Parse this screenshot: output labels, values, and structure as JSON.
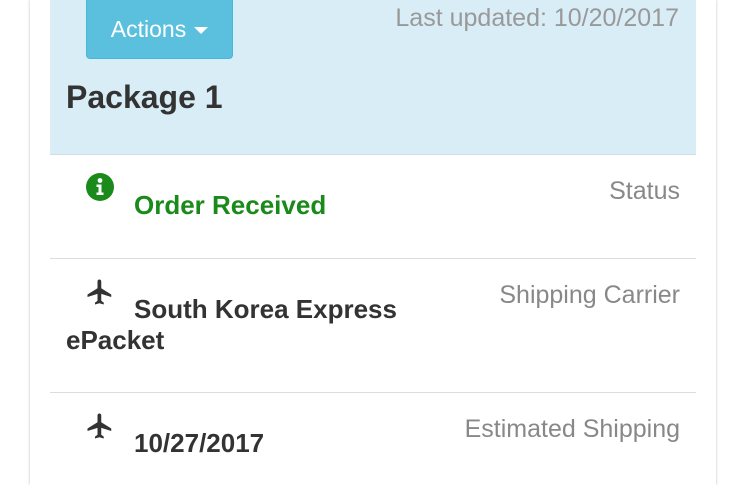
{
  "header": {
    "actions_label": "Actions",
    "last_updated": "Last updated: 10/20/2017",
    "package_title": "Package 1",
    "bg_color": "#d9edf7",
    "button_color": "#5bc0de"
  },
  "rows": [
    {
      "icon": "info-circle-icon",
      "value": "Order Received",
      "label": "Status",
      "value_color": "#1a8a1a"
    },
    {
      "icon": "airplane-icon",
      "value": "South Korea Express ePacket",
      "label": "Shipping Carrier"
    },
    {
      "icon": "airplane-icon",
      "value": "10/27/2017",
      "label": "Estimated Shipping"
    }
  ]
}
